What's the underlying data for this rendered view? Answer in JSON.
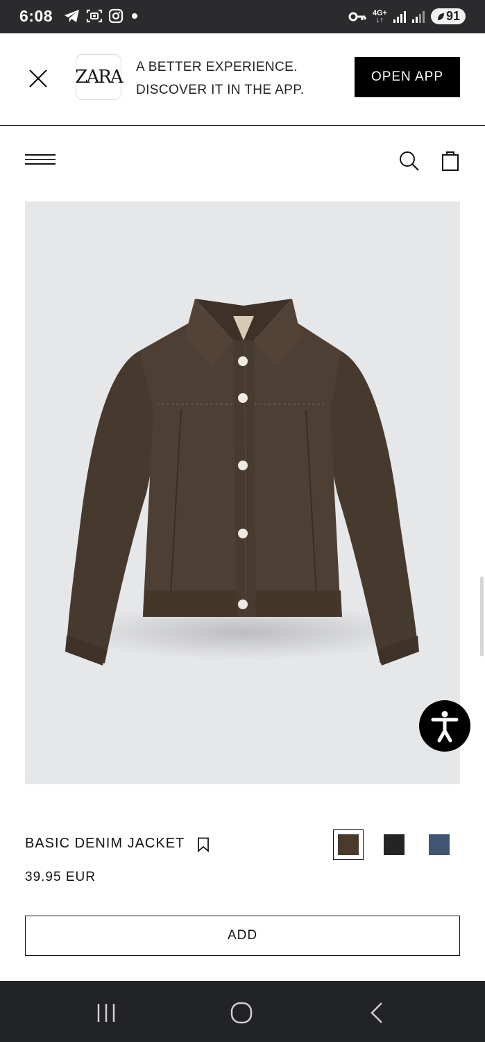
{
  "status_bar": {
    "time": "6:08",
    "notification_icons": [
      "telegram-icon",
      "screenshot-icon",
      "instagram-icon",
      "dot-icon"
    ],
    "network_label_top": "4G+",
    "network_label_bottom": "↓↑",
    "battery": "91"
  },
  "app_banner": {
    "logo_text": "ZARA",
    "line1": "A BETTER EXPERIENCE.",
    "line2": "DISCOVER IT IN THE APP.",
    "open_app_label": "OPEN APP"
  },
  "nav": {
    "icons": [
      "menu-icon",
      "search-icon",
      "shopping-bag-icon"
    ]
  },
  "product": {
    "name": "BASIC DENIM JACKET",
    "price": "39.95 EUR",
    "add_label": "ADD",
    "colors": [
      {
        "hex": "#4a3a2c",
        "selected": true
      },
      {
        "hex": "#242424",
        "selected": false
      },
      {
        "hex": "#3f5571",
        "selected": false
      }
    ],
    "image_background": "#e6e7e9",
    "jacket_color": "#4d3f33"
  },
  "system_nav": {
    "icons": [
      "recents-icon",
      "home-icon",
      "back-icon"
    ]
  }
}
